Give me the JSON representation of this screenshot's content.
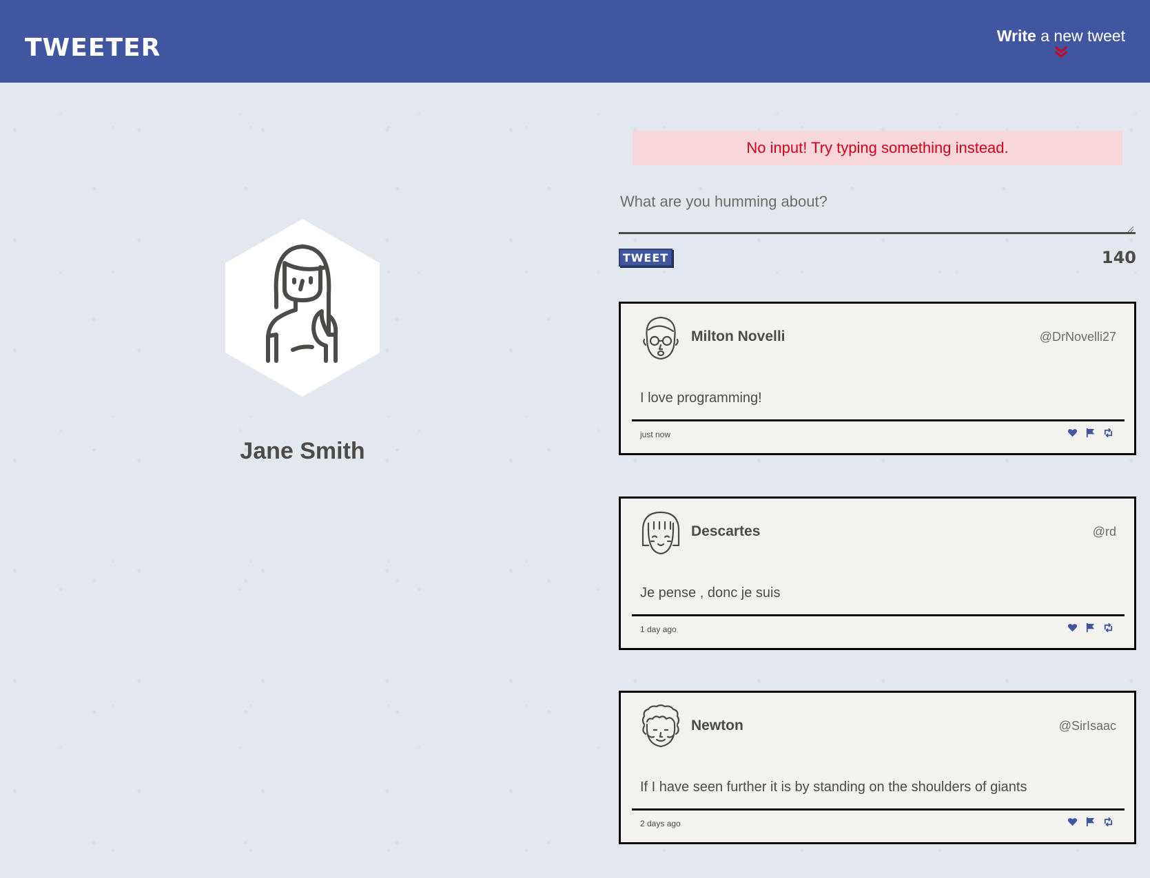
{
  "nav": {
    "logo": "TWEETER",
    "compose_strong": "Write",
    "compose_rest": " a new tweet",
    "compose_icon": "chevron-double-down-icon",
    "accent_color": "#4056a1",
    "chevron_color": "#d0021b"
  },
  "profile": {
    "name": "Jane Smith",
    "avatar_icon": "woman-avatar-icon"
  },
  "error": {
    "message": "No input! Try typing something instead."
  },
  "composer": {
    "placeholder": "What are you humming about?",
    "value": "",
    "button_label": "TWEET",
    "counter": "140"
  },
  "tweets": [
    {
      "name": "Milton Novelli",
      "handle": "@DrNovelli27",
      "content": "I love programming!",
      "time": "just now",
      "avatar_icon": "man-glasses-avatar-icon"
    },
    {
      "name": "Descartes",
      "handle": "@rd",
      "content": "Je pense , donc je suis",
      "time": "1 day ago",
      "avatar_icon": "bob-hair-avatar-icon"
    },
    {
      "name": "Newton",
      "handle": "@SirIsaac",
      "content": "If I have seen further it is by standing on the shoulders of giants",
      "time": "2 days ago",
      "avatar_icon": "curly-hair-avatar-icon"
    }
  ],
  "tweet_action_icons": [
    "heart-icon",
    "flag-icon",
    "retweet-icon"
  ]
}
